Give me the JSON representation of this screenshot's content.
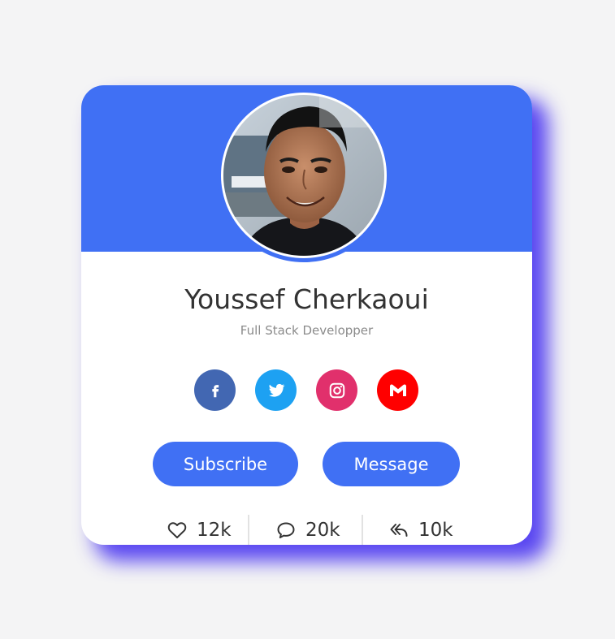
{
  "profile": {
    "name": "Youssef Cherkaoui",
    "job": "Full Stack Developper"
  },
  "socials": [
    {
      "icon": "facebook-icon",
      "color": "#4267b2"
    },
    {
      "icon": "twitter-icon",
      "color": "#1da1f2"
    },
    {
      "icon": "instagram-icon",
      "color": "#e1306c"
    },
    {
      "icon": "gmail-icon",
      "color": "#ff0000"
    }
  ],
  "buttons": {
    "subscribe": "Subscribe",
    "message": "Message"
  },
  "stats": {
    "likes": "12k",
    "comments": "20k",
    "shares": "10k"
  },
  "colors": {
    "accent": "#4070f4",
    "shadow": "#3e28f0",
    "background": "#f4f4f5"
  }
}
